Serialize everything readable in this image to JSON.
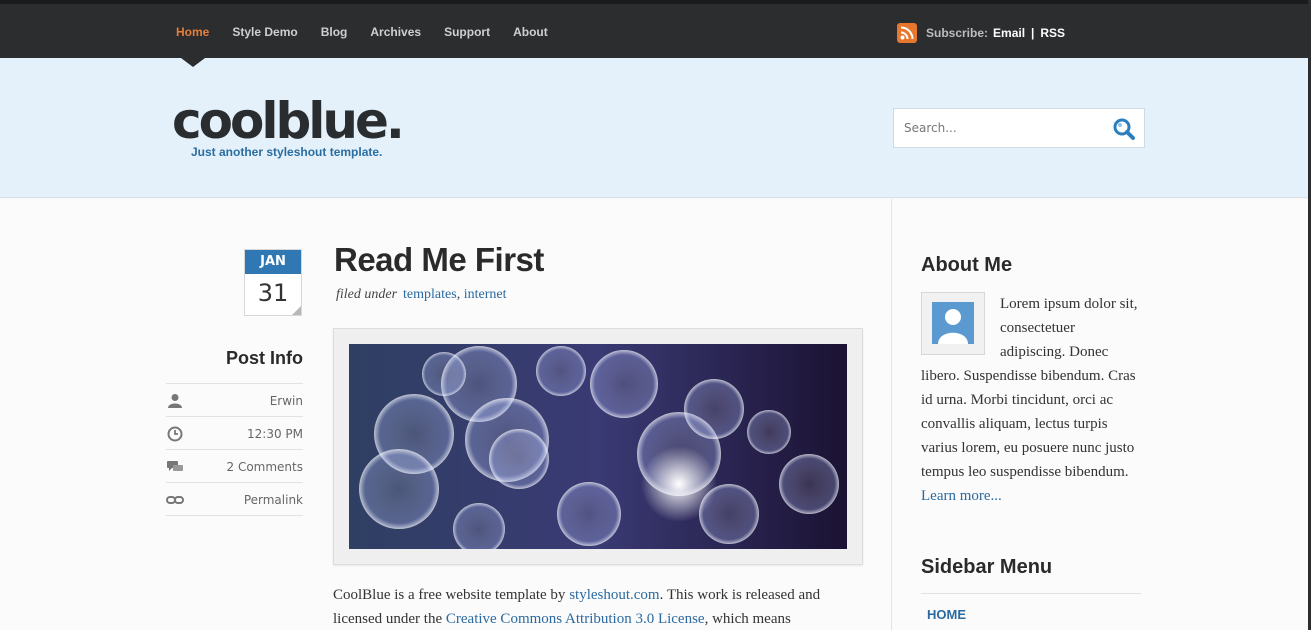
{
  "nav": {
    "items": [
      {
        "label": "Home",
        "active": true
      },
      {
        "label": "Style Demo",
        "active": false
      },
      {
        "label": "Blog",
        "active": false
      },
      {
        "label": "Archives",
        "active": false
      },
      {
        "label": "Support",
        "active": false
      },
      {
        "label": "About",
        "active": false
      }
    ]
  },
  "subscribe": {
    "label": "Subscribe:",
    "email": "Email",
    "separator": "|",
    "rss": "RSS",
    "icon": "rss-icon"
  },
  "header": {
    "logo": "coolblue.",
    "slogan": "Just another styleshout template.",
    "search_placeholder": "Search..."
  },
  "post": {
    "date_month": "JAN",
    "date_day": "31",
    "title": "Read Me First",
    "filed_label": "filed under",
    "tags": [
      "templates",
      "internet"
    ],
    "tag_separator": ",",
    "info_title": "Post Info",
    "info": [
      {
        "icon": "user-icon",
        "text": "Erwin"
      },
      {
        "icon": "clock-icon",
        "text": "12:30 PM"
      },
      {
        "icon": "comments-icon",
        "text": "2 Comments"
      },
      {
        "icon": "link-icon",
        "text": "Permalink"
      }
    ],
    "body": {
      "part1": "CoolBlue is a free website template by ",
      "link1": "styleshout.com",
      "part2": ". This work is released and licensed under the ",
      "link2": "Creative Commons Attribution 3.0 License",
      "part3": ", which means"
    }
  },
  "sidebar": {
    "about_title": "About Me",
    "about_text": "Lorem ipsum dolor sit, consectetuer adipiscing. Donec libero. Suspendisse bibendum. Cras id urna. Morbi tincidunt, orci ac convallis aliquam, lectus turpis varius lorem, eu posuere nunc justo tempus leo suspendisse bibendum. ",
    "learn_more": "Learn more...",
    "menu_title": "Sidebar Menu",
    "menu_items": [
      "HOME"
    ]
  },
  "colors": {
    "accent": "#e67e3a",
    "link": "#2b6aa0",
    "topbar": "#2b2d2f",
    "header_bg": "#e4f1fb"
  }
}
